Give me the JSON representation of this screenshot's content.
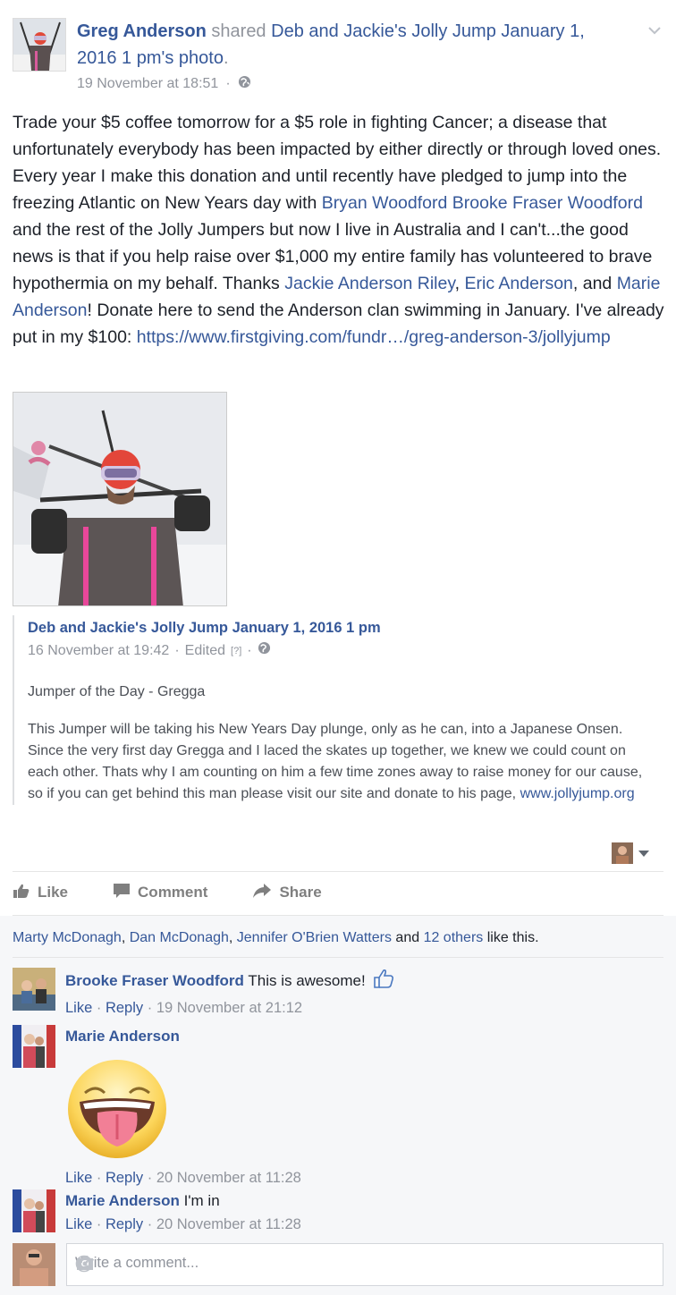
{
  "header": {
    "author": "Greg Anderson",
    "verb": "shared",
    "source": "Deb and Jackie's Jolly Jump January 1, 2016 1 pm",
    "possessive": "'s",
    "object": "photo",
    "period": ".",
    "timestamp": "19 November at 18:51",
    "dot": "·"
  },
  "post": {
    "t1": "Trade your $5 coffee tomorrow for a $5 role in fighting Cancer; a disease that unfortunately everybody has been impacted by either directly or through loved ones. Every year I make this donation and until recently have pledged to jump into the freezing Atlantic on New Years day with ",
    "m1": "Bryan Woodford",
    "t2": " ",
    "m2": "Brooke Fraser Woodford",
    "t3": " and the rest of the Jolly Jumpers but now I live in Australia and I can't...the good news is that if you help raise over $1,000 my entire family has volunteered to brave hypothermia on my behalf. Thanks ",
    "m3": "Jackie Anderson Riley",
    "t4": ", ",
    "m4": "Eric Anderson",
    "t5": ", and ",
    "m5": "Marie Anderson",
    "t6": "! Donate here to send the Anderson clan swimming in January. I've already put in my $100: ",
    "url": "https://www.firstgiving.com/fundr…/greg-anderson-3/jollyjump"
  },
  "shared": {
    "title": "Deb and Jackie's Jolly Jump January 1, 2016 1 pm",
    "timestamp": "16 November at 19:42",
    "sep": "·",
    "edited": "Edited",
    "edited_q": "[?]",
    "subtitle": "Jumper of the Day - Gregga",
    "body": "This Jumper will be taking his New Years Day plunge, only as he can, into a Japanese Onsen. Since the very first day Gregga and I laced the skates up together, we knew we could count on each other. Thats why I am counting on him a few time zones away to raise money for our cause, so if you can get behind this man please visit our site and donate to his page, ",
    "link": "www.jollyjump.org"
  },
  "actions": {
    "like": "Like",
    "comment": "Comment",
    "share": "Share"
  },
  "likes": {
    "n1": "Marty McDonagh",
    "sep1": ", ",
    "n2": "Dan McDonagh",
    "sep2": ", ",
    "n3": "Jennifer O'Brien Watters",
    "and": " and ",
    "others": "12 others",
    "tail": " like this."
  },
  "comments": [
    {
      "name": "Brooke Fraser Woodford",
      "text": " This is awesome!",
      "like": "Like",
      "reply": "Reply",
      "time": "19 November at 21:12"
    },
    {
      "name": "Marie Anderson",
      "text": "",
      "like": "Like",
      "reply": "Reply",
      "time": "20 November at 11:28"
    },
    {
      "name": "Marie Anderson",
      "text": " I'm in",
      "like": "Like",
      "reply": "Reply",
      "time": "20 November at 11:28"
    }
  ],
  "meta_sep": " · ",
  "composer": {
    "placeholder": "Write a comment..."
  },
  "icons": {
    "globe": "globe-icon",
    "chevron": "chevron-down-icon",
    "like": "thumbs-up-icon",
    "comment": "comment-icon",
    "share": "share-arrow-icon",
    "camera": "camera-icon",
    "emoji": "emoji-icon",
    "sticker": "tongue-out-sticker"
  },
  "colors": {
    "link": "#365899",
    "meta": "#90949c",
    "text": "#1d2129",
    "comment_bg": "#f6f7f9"
  }
}
